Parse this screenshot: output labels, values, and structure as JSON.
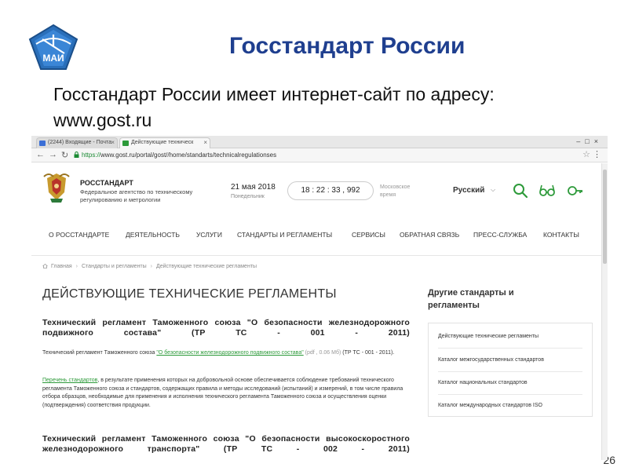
{
  "slide": {
    "title": "Госстандарт России",
    "intro_line1": "Госстандарт России имеет интернет-сайт по адресу:",
    "intro_line2": "www.gost.ru",
    "page_number": "26",
    "logo_text": "МАИ"
  },
  "browser": {
    "tabs": [
      {
        "label": "(2244) Входящие - Почта",
        "active": false
      },
      {
        "label": "Действующие техническ",
        "active": true
      }
    ],
    "url_scheme": "https://",
    "url_rest": "www.gost.ru/portal/gost//home/standarts/technicalregulationses"
  },
  "site": {
    "org_name": "РОССТАНДАРТ",
    "org_desc": "Федеральное агентство по техническому регулированию и метрологии",
    "date": "21 мая 2018",
    "weekday": "Понедельник",
    "clock": "18 : 22 : 33 , 992",
    "timezone": "Московское время",
    "language": "Русский",
    "icons": [
      "search-icon",
      "glasses-icon",
      "key-icon"
    ],
    "nav": [
      "О РОССТАНДАРТЕ",
      "ДЕЯТЕЛЬНОСТЬ",
      "УСЛУГИ",
      "СТАНДАРТЫ И РЕГЛАМЕНТЫ",
      "СЕРВИСЫ",
      "ОБРАТНАЯ СВЯЗЬ",
      "ПРЕСС-СЛУЖБА",
      "КОНТАКТЫ"
    ],
    "breadcrumb": [
      "Главная",
      "Стандарты и регламенты",
      "Действующие технические регламенты"
    ],
    "page_title": "ДЕЙСТВУЮЩИЕ ТЕХНИЧЕСКИЕ РЕГЛАМЕНТЫ",
    "reg1_title": "Технический регламент Таможенного союза \"О безопасности железнодорожного подвижного состава\" (ТР ТС - 001 - 2011)",
    "reg1_prefix": "Технический регламент Таможенного союза ",
    "reg1_link": "\"О безопасности железнодорожного подвижного состава\"",
    "reg1_file": " (pdf , 0.06 Мб)",
    "reg1_suffix": " (ТР ТС - 001 - 2011).",
    "list_link": "Перечень стандартов",
    "list_text": ", в результате применения которых на добровольной основе обеспечивается соблюдение требований технического регламента Таможенного союза и стандартов, содержащих правила и методы исследований (испытаний) и измерений, в том числе правила отбора образцов, необходимые для применения и исполнения технического регламента Таможенного союза и осуществления оценки (подтверждения) соответствия продукции.",
    "reg2_title": "Технический регламент Таможенного союза \"О безопасности высокоскоростного железнодорожного транспорта\" (ТР ТС - 002 - 2011)",
    "sidebar_title": "Другие стандарты и регламенты",
    "sidebar_links": [
      "Действующие технические регламенты",
      "Каталог межгосударственных стандартов",
      "Каталог национальных стандартов",
      "Каталог международных стандартов ISO"
    ]
  },
  "colors": {
    "slide_title": "#1f3f8f",
    "site_accent": "#2d9a3a"
  }
}
